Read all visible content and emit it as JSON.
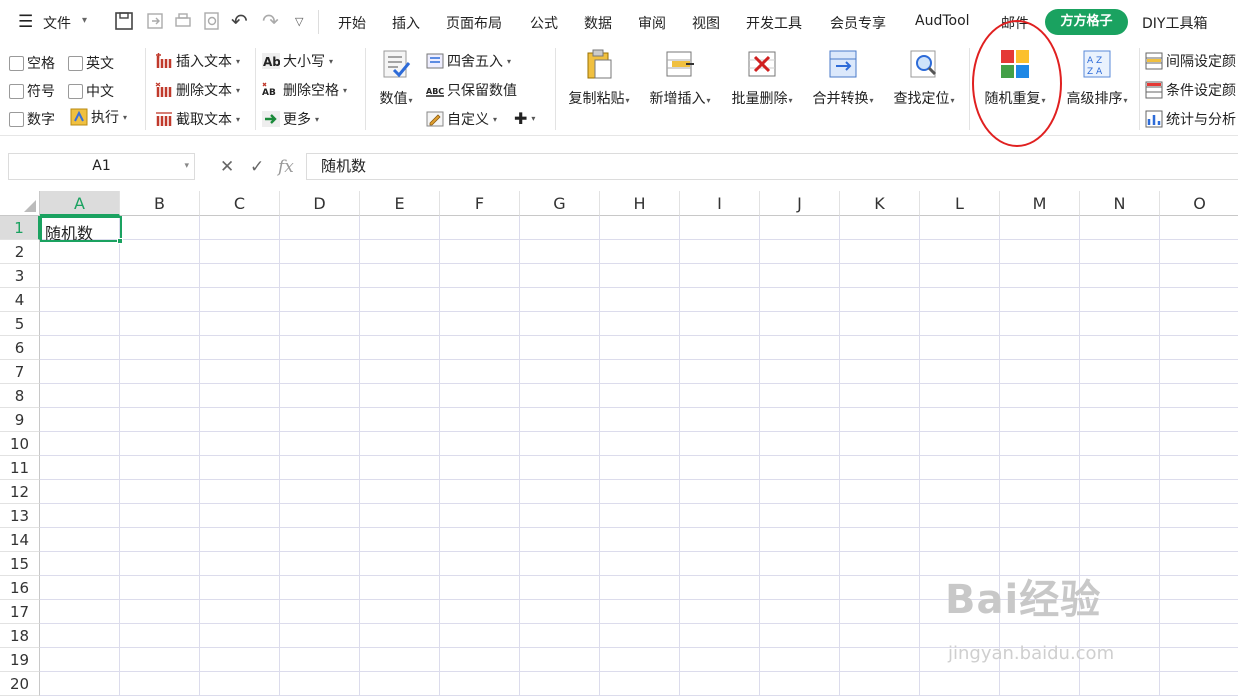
{
  "menubar": {
    "file_label": "文件",
    "tabs": [
      "开始",
      "插入",
      "页面布局",
      "公式",
      "数据",
      "审阅",
      "视图",
      "开发工具",
      "会员专享",
      "AudTool",
      "邮件"
    ],
    "active_tab": "方方格子",
    "tab_after": "DIY工具箱"
  },
  "ribbon": {
    "checkboxes": [
      "空格",
      "英文",
      "符号",
      "中文",
      "数字"
    ],
    "execute_label": "执行",
    "text_group": [
      "插入文本",
      "删除文本",
      "截取文本"
    ],
    "case_group": [
      "大小写",
      "删除空格",
      "更多"
    ],
    "numeric_label": "数值",
    "round_group": [
      "四舍五入",
      "只保留数值",
      "自定义"
    ],
    "big_buttons": [
      "复制粘贴",
      "新增插入",
      "批量删除",
      "合并转换",
      "查找定位",
      "随机重复",
      "高级排序"
    ],
    "right_group": [
      "间隔设定颜",
      "条件设定颜",
      "统计与分析"
    ]
  },
  "formula_bar": {
    "cell_ref": "A1",
    "cancel_icon": "✕",
    "confirm_icon": "✓",
    "fx_label": "fx",
    "content": "随机数"
  },
  "sheet": {
    "columns": [
      "A",
      "B",
      "C",
      "D",
      "E",
      "F",
      "G",
      "H",
      "I",
      "J",
      "K",
      "L",
      "M",
      "N",
      "O"
    ],
    "rows": [
      "1",
      "2",
      "3",
      "4",
      "5",
      "6",
      "7",
      "8",
      "9",
      "10",
      "11",
      "12",
      "13",
      "14",
      "15",
      "16",
      "17",
      "18",
      "19",
      "20"
    ],
    "a1_value": "随机数"
  },
  "watermark": {
    "brand": "Bai经验",
    "url": "jingyan.baidu.com"
  },
  "colors": {
    "accent": "#1aa260",
    "highlight_circle": "#e02020"
  }
}
